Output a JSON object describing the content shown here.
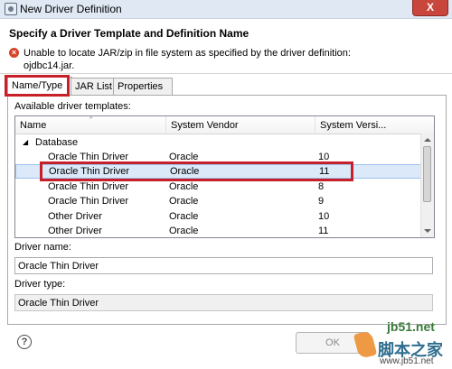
{
  "window": {
    "title": "New Driver Definition",
    "close_glyph": "X"
  },
  "header": {
    "title": "Specify a Driver Template and Definition Name",
    "error_line1": "Unable to locate JAR/zip in file system as specified by the driver definition:",
    "error_line2": "ojdbc14.jar."
  },
  "tabs": [
    {
      "label": "Name/Type",
      "active": true
    },
    {
      "label": "JAR List",
      "active": false
    },
    {
      "label": "Properties",
      "active": false
    }
  ],
  "templates_label": "Available driver templates:",
  "table": {
    "columns": [
      "Name",
      "System Vendor",
      "System Versi..."
    ],
    "group": "Database",
    "rows": [
      {
        "name": "Oracle Thin Driver",
        "vendor": "Oracle",
        "version": "10"
      },
      {
        "name": "Oracle Thin Driver",
        "vendor": "Oracle",
        "version": "11"
      },
      {
        "name": "Oracle Thin Driver",
        "vendor": "Oracle",
        "version": "8"
      },
      {
        "name": "Oracle Thin Driver",
        "vendor": "Oracle",
        "version": "9"
      },
      {
        "name": "Other Driver",
        "vendor": "Oracle",
        "version": "10"
      },
      {
        "name": "Other Driver",
        "vendor": "Oracle",
        "version": "11"
      }
    ],
    "selected_index": 1
  },
  "driver_name": {
    "label": "Driver name:",
    "value": "Oracle Thin Driver"
  },
  "driver_type": {
    "label": "Driver type:",
    "value": "Oracle Thin Driver"
  },
  "buttons": {
    "help": "?",
    "ok": "OK"
  },
  "watermark": {
    "brand": "jb51.net",
    "cn": "脚本之家",
    "url": "www.jb51.net"
  },
  "colors": {
    "highlight_box": "#c8202a",
    "selection": "#dbe9f8",
    "error": "#d8432c"
  }
}
